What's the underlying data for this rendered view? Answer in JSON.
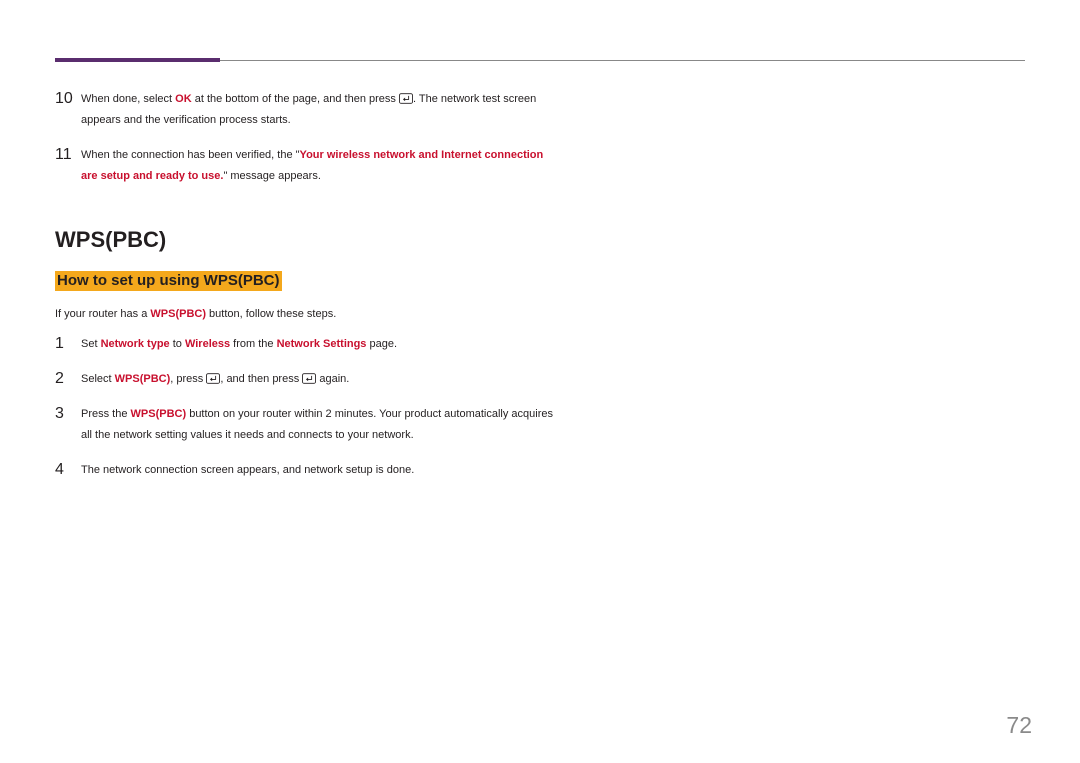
{
  "page_number": "72",
  "top_steps": [
    {
      "num": "10",
      "parts": [
        {
          "t": "When done, select ",
          "c": ""
        },
        {
          "t": "OK",
          "c": "bold-accent"
        },
        {
          "t": " at the bottom of the page, and then press ",
          "c": ""
        },
        {
          "icon": "enter"
        },
        {
          "t": ". The network test screen appears and the verification process starts.",
          "c": ""
        }
      ]
    },
    {
      "num": "11",
      "parts": [
        {
          "t": "When the connection has been verified, the \"",
          "c": ""
        },
        {
          "t": "Your wireless network and Internet connection are setup and ready to use.",
          "c": "bold-accent"
        },
        {
          "t": "\" message appears.",
          "c": ""
        }
      ]
    }
  ],
  "section_title": "WPS(PBC)",
  "sub_title": "How to set up using WPS(PBC)",
  "intro": {
    "parts": [
      {
        "t": "If your router has a ",
        "c": ""
      },
      {
        "t": "WPS(PBC)",
        "c": "bold-accent"
      },
      {
        "t": " button, follow these steps.",
        "c": ""
      }
    ]
  },
  "bottom_steps": [
    {
      "num": "1",
      "parts": [
        {
          "t": "Set ",
          "c": ""
        },
        {
          "t": "Network type",
          "c": "bold-accent"
        },
        {
          "t": " to ",
          "c": ""
        },
        {
          "t": "Wireless",
          "c": "bold-accent"
        },
        {
          "t": " from the ",
          "c": ""
        },
        {
          "t": "Network Settings",
          "c": "bold-accent"
        },
        {
          "t": " page.",
          "c": ""
        }
      ]
    },
    {
      "num": "2",
      "parts": [
        {
          "t": "Select ",
          "c": ""
        },
        {
          "t": "WPS(PBC)",
          "c": "bold-accent"
        },
        {
          "t": ", press ",
          "c": ""
        },
        {
          "icon": "enter"
        },
        {
          "t": ", and then press ",
          "c": ""
        },
        {
          "icon": "enter"
        },
        {
          "t": " again.",
          "c": ""
        }
      ]
    },
    {
      "num": "3",
      "parts": [
        {
          "t": "Press the ",
          "c": ""
        },
        {
          "t": "WPS(PBC)",
          "c": "bold-accent"
        },
        {
          "t": " button on your router within 2 minutes. Your product automatically acquires all the network setting values it needs and connects to your network.",
          "c": ""
        }
      ]
    },
    {
      "num": "4",
      "parts": [
        {
          "t": "The network connection screen appears, and network setup is done.",
          "c": ""
        }
      ]
    }
  ]
}
